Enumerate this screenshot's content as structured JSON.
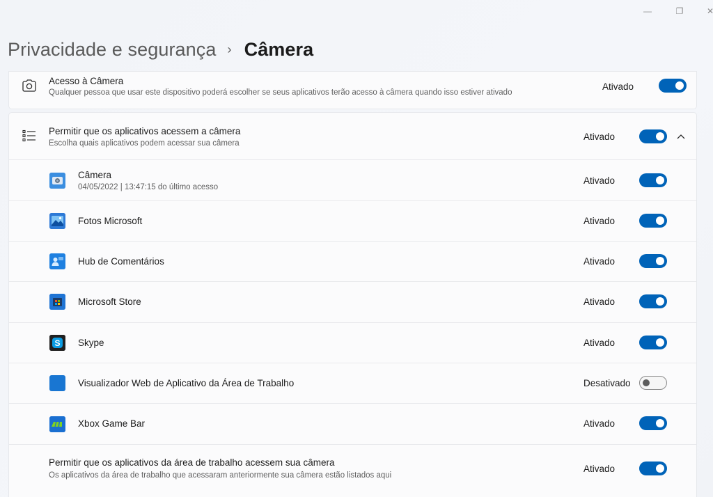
{
  "window": {
    "minimize_icon": "minimize-icon",
    "maximize_icon": "restore-icon",
    "close_icon": "close-icon",
    "min_glyph": "—",
    "max_glyph": "❐",
    "close_glyph": "✕"
  },
  "breadcrumb": {
    "parent": "Privacidade e segurança",
    "separator": "›",
    "current": "Câmera"
  },
  "camera_access": {
    "title": "Acesso à Câmera",
    "subtitle": "Qualquer pessoa que usar este dispositivo poderá escolher se seus aplicativos terão acesso à câmera quando isso estiver ativado",
    "status": "Ativado",
    "enabled": true
  },
  "apps_access": {
    "title": "Permitir que os aplicativos acessem a câmera",
    "subtitle": "Escolha quais aplicativos podem acessar sua câmera",
    "status": "Ativado",
    "enabled": true,
    "expanded": true
  },
  "apps": [
    {
      "name": "Câmera",
      "detail": "04/05/2022  |  13:47:15 do último acesso",
      "status": "Ativado",
      "enabled": true,
      "icon": "camera-app-icon"
    },
    {
      "name": "Fotos Microsoft",
      "detail": "",
      "status": "Ativado",
      "enabled": true,
      "icon": "photos-app-icon"
    },
    {
      "name": "Hub de Comentários",
      "detail": "",
      "status": "Ativado",
      "enabled": true,
      "icon": "feedback-hub-icon"
    },
    {
      "name": "Microsoft Store",
      "detail": "",
      "status": "Ativado",
      "enabled": true,
      "icon": "store-app-icon"
    },
    {
      "name": "Skype",
      "detail": "",
      "status": "Ativado",
      "enabled": true,
      "icon": "skype-app-icon"
    },
    {
      "name": "Visualizador Web de Aplicativo da Área de Trabalho",
      "detail": "",
      "status": "Desativado",
      "enabled": false,
      "icon": "web-viewer-app-icon"
    },
    {
      "name": "Xbox Game Bar",
      "detail": "",
      "status": "Ativado",
      "enabled": true,
      "icon": "xbox-game-bar-icon"
    }
  ],
  "desktop_apps": {
    "title": "Permitir que os aplicativos da área de trabalho acessem sua câmera",
    "subtitle": "Os aplicativos da área de trabalho que acessaram anteriormente sua câmera estão listados aqui",
    "status": "Ativado",
    "enabled": true
  },
  "colors": {
    "accent": "#0063b8",
    "card_bg": "#fbfbfc",
    "page_bg": "#f3f5f9"
  }
}
